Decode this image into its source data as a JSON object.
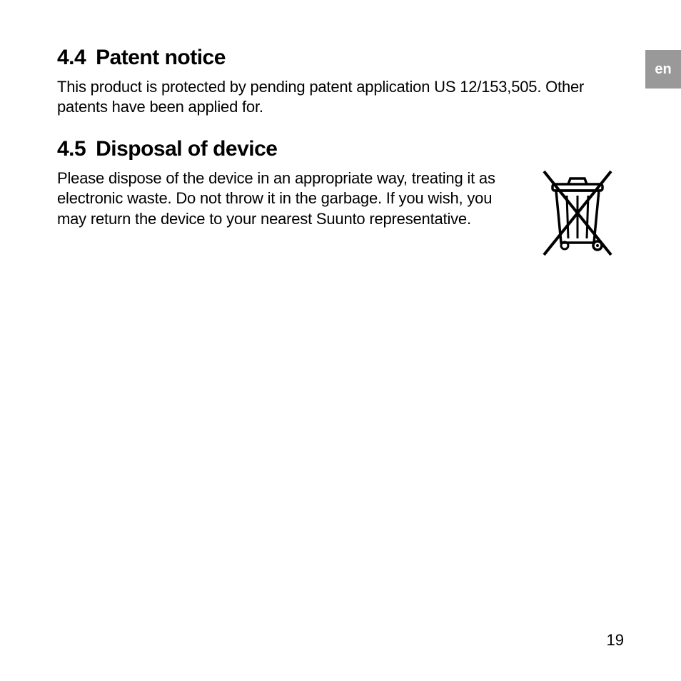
{
  "language_tab": "en",
  "sections": {
    "patent": {
      "number": "4.4",
      "title": "Patent notice",
      "body": "This product is protected by pending patent application US 12/153,505. Other patents have been applied for."
    },
    "disposal": {
      "number": "4.5",
      "title": "Disposal of device",
      "body": "Please dispose of the device in an appropriate way, treating it as electronic waste. Do not throw it in the garbage. If you wish, you may return the device to your nearest Suunto representative."
    }
  },
  "page_number": "19"
}
